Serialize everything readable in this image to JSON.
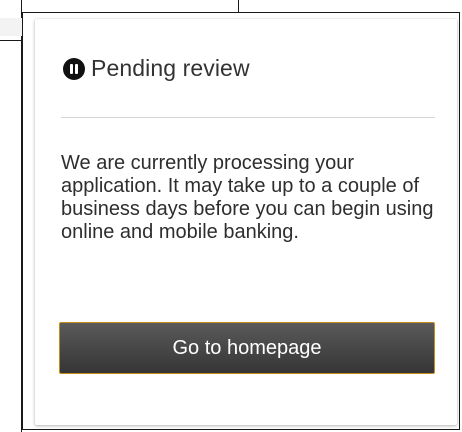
{
  "status_card": {
    "icon": "pause-circle-icon",
    "title": "Pending review",
    "message": "We are currently processing your application. It may take up to a couple of business days before you can begin using online and mobile banking.",
    "button_label": "Go to homepage"
  },
  "colors": {
    "button_background": "#474747",
    "button_border": "#c98a1c",
    "title_text": "#333333",
    "icon_fill": "#111111"
  }
}
